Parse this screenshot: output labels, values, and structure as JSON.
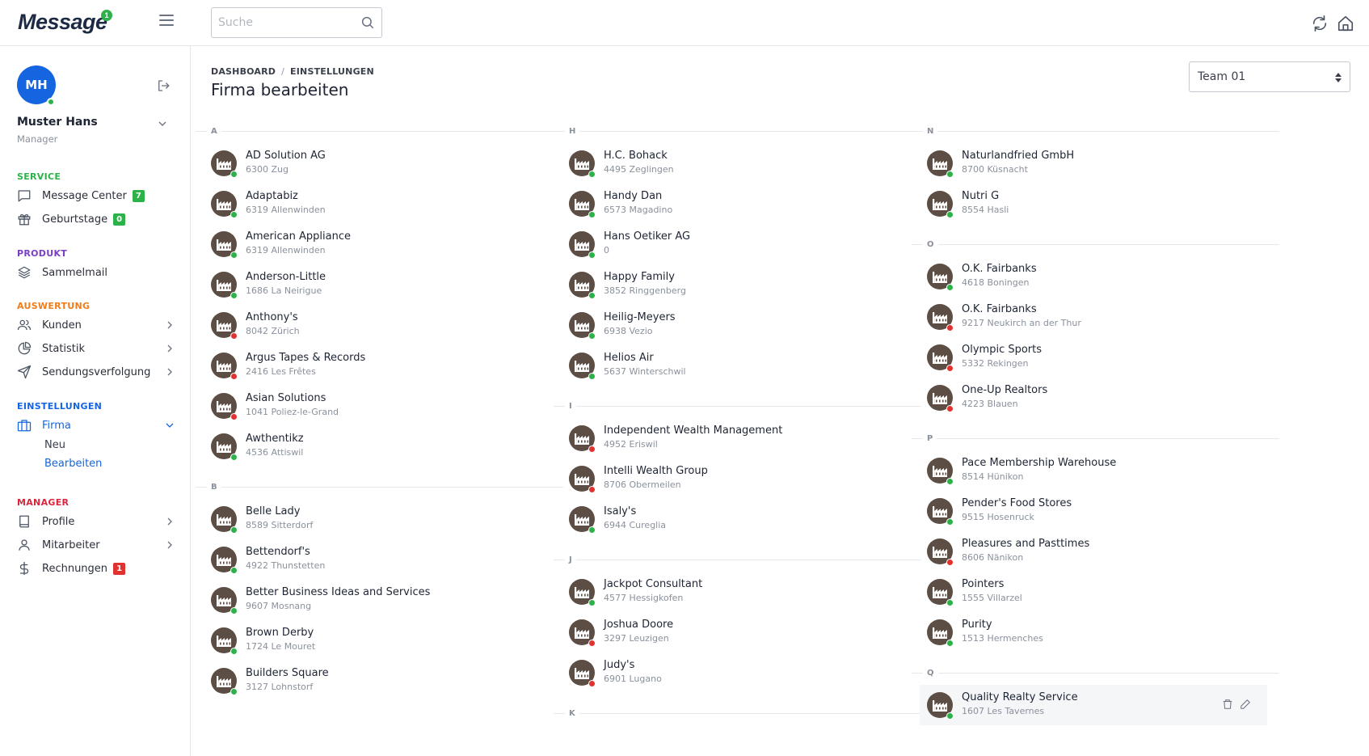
{
  "header": {
    "logo_text": "Message",
    "logo_badge": "1",
    "search": {
      "placeholder": "Suche",
      "value": ""
    }
  },
  "user": {
    "initials": "MH",
    "name": "Muster Hans",
    "role": "Manager",
    "status_color": "#2db24a"
  },
  "colors": {
    "green": "#2db24a",
    "red": "#e0322f",
    "blue": "#1565e0",
    "icon_bg": "#5c4e44",
    "service": "#2db24a",
    "produkt": "#7a3fc4",
    "auswertung": "#f07d1a",
    "einstellungen": "#1565e0",
    "manager": "#d7263d"
  },
  "sidebar": {
    "service": {
      "title": "SERVICE",
      "items": [
        {
          "label": "Message Center",
          "badge": "7",
          "icon": "chat-icon"
        },
        {
          "label": "Geburtstage",
          "badge": "0",
          "icon": "gift-icon"
        }
      ]
    },
    "produkt": {
      "title": "PRODUKT",
      "items": [
        {
          "label": "Sammelmail",
          "icon": "layers-icon"
        }
      ]
    },
    "auswertung": {
      "title": "AUSWERTUNG",
      "items": [
        {
          "label": "Kunden",
          "icon": "users-icon"
        },
        {
          "label": "Statistik",
          "icon": "pie-chart-icon"
        },
        {
          "label": "Sendungsverfolgung",
          "icon": "send-icon"
        }
      ]
    },
    "einstellungen": {
      "title": "EINSTELLUNGEN",
      "items": [
        {
          "label": "Firma",
          "icon": "briefcase-icon",
          "sub": [
            "Neu",
            "Bearbeiten"
          ]
        }
      ]
    },
    "manager": {
      "title": "MANAGER",
      "items": [
        {
          "label": "Profile",
          "icon": "book-icon"
        },
        {
          "label": "Mitarbeiter",
          "icon": "user-icon"
        },
        {
          "label": "Rechnungen",
          "badge": "1",
          "icon": "dollar-icon"
        }
      ]
    }
  },
  "main": {
    "breadcrumb": [
      "DASHBOARD",
      "EINSTELLUNGEN"
    ],
    "title": "Firma bearbeiten",
    "team_select": "Team 01",
    "columns": [
      [
        {
          "letter": "A",
          "items": [
            {
              "name": "AD Solution AG",
              "addr": "6300 Zug",
              "status": "green"
            },
            {
              "name": "Adaptabiz",
              "addr": "6319 Allenwinden",
              "status": "green"
            },
            {
              "name": "American Appliance",
              "addr": "6319 Allenwinden",
              "status": "green"
            },
            {
              "name": "Anderson-Little",
              "addr": "1686 La Neirigue",
              "status": "green"
            },
            {
              "name": "Anthony's",
              "addr": "8042 Zürich",
              "status": "red"
            },
            {
              "name": "Argus Tapes & Records",
              "addr": "2416 Les Frêtes",
              "status": "red"
            },
            {
              "name": "Asian Solutions",
              "addr": "1041 Poliez-le-Grand",
              "status": "red"
            },
            {
              "name": "Awthentikz",
              "addr": "4536 Attiswil",
              "status": "green"
            }
          ]
        },
        {
          "letter": "B",
          "items": [
            {
              "name": "Belle Lady",
              "addr": "8589 Sitterdorf",
              "status": "green"
            },
            {
              "name": "Bettendorf's",
              "addr": "4922 Thunstetten",
              "status": "green"
            },
            {
              "name": "Better Business Ideas and Services",
              "addr": "9607 Mosnang",
              "status": "green"
            },
            {
              "name": "Brown Derby",
              "addr": "1724 Le Mouret",
              "status": "green"
            },
            {
              "name": "Builders Square",
              "addr": "3127 Lohnstorf",
              "status": "green"
            }
          ]
        }
      ],
      [
        {
          "letter": "H",
          "items": [
            {
              "name": "H.C. Bohack",
              "addr": "4495 Zeglingen",
              "status": "green"
            },
            {
              "name": "Handy Dan",
              "addr": "6573 Magadino",
              "status": "green"
            },
            {
              "name": "Hans Oetiker AG",
              "addr": "0",
              "status": "green"
            },
            {
              "name": "Happy Family",
              "addr": "3852 Ringgenberg",
              "status": "green"
            },
            {
              "name": "Heilig-Meyers",
              "addr": "6938 Vezio",
              "status": "green"
            },
            {
              "name": "Helios Air",
              "addr": "5637 Winterschwil",
              "status": "green"
            }
          ]
        },
        {
          "letter": "I",
          "items": [
            {
              "name": "Independent Wealth Management",
              "addr": "4952 Eriswil",
              "status": "red"
            },
            {
              "name": "Intelli Wealth Group",
              "addr": "8706 Obermeilen",
              "status": "red"
            },
            {
              "name": "Isaly's",
              "addr": "6944 Cureglia",
              "status": "green"
            }
          ]
        },
        {
          "letter": "J",
          "items": [
            {
              "name": "Jackpot Consultant",
              "addr": "4577 Hessigkofen",
              "status": "green"
            },
            {
              "name": "Joshua Doore",
              "addr": "3297 Leuzigen",
              "status": "red"
            },
            {
              "name": "Judy's",
              "addr": "6901 Lugano",
              "status": "red"
            }
          ]
        },
        {
          "letter": "K",
          "items": []
        }
      ],
      [
        {
          "letter": "N",
          "items": [
            {
              "name": "Naturlandfried GmbH",
              "addr": "8700 Küsnacht",
              "status": "green"
            },
            {
              "name": "Nutri G",
              "addr": "8554 Hasli",
              "status": "green"
            }
          ]
        },
        {
          "letter": "O",
          "items": [
            {
              "name": "O.K. Fairbanks",
              "addr": "4618 Boningen",
              "status": "green"
            },
            {
              "name": "O.K. Fairbanks",
              "addr": "9217 Neukirch an der Thur",
              "status": "red"
            },
            {
              "name": "Olympic Sports",
              "addr": "5332 Rekingen",
              "status": "red"
            },
            {
              "name": "One-Up Realtors",
              "addr": "4223 Blauen",
              "status": "red"
            }
          ]
        },
        {
          "letter": "P",
          "items": [
            {
              "name": "Pace Membership Warehouse",
              "addr": "8514 Hünikon",
              "status": "green"
            },
            {
              "name": "Pender's Food Stores",
              "addr": "9515 Hosenruck",
              "status": "green"
            },
            {
              "name": "Pleasures and Pasttimes",
              "addr": "8606 Nänikon",
              "status": "red"
            },
            {
              "name": "Pointers",
              "addr": "1555 Villarzel",
              "status": "green"
            },
            {
              "name": "Purity",
              "addr": "1513 Hermenches",
              "status": "green"
            }
          ]
        },
        {
          "letter": "Q",
          "items": [
            {
              "name": "Quality Realty Service",
              "addr": "1607 Les Tavernes",
              "status": "green",
              "hovered": true
            }
          ]
        }
      ]
    ]
  }
}
